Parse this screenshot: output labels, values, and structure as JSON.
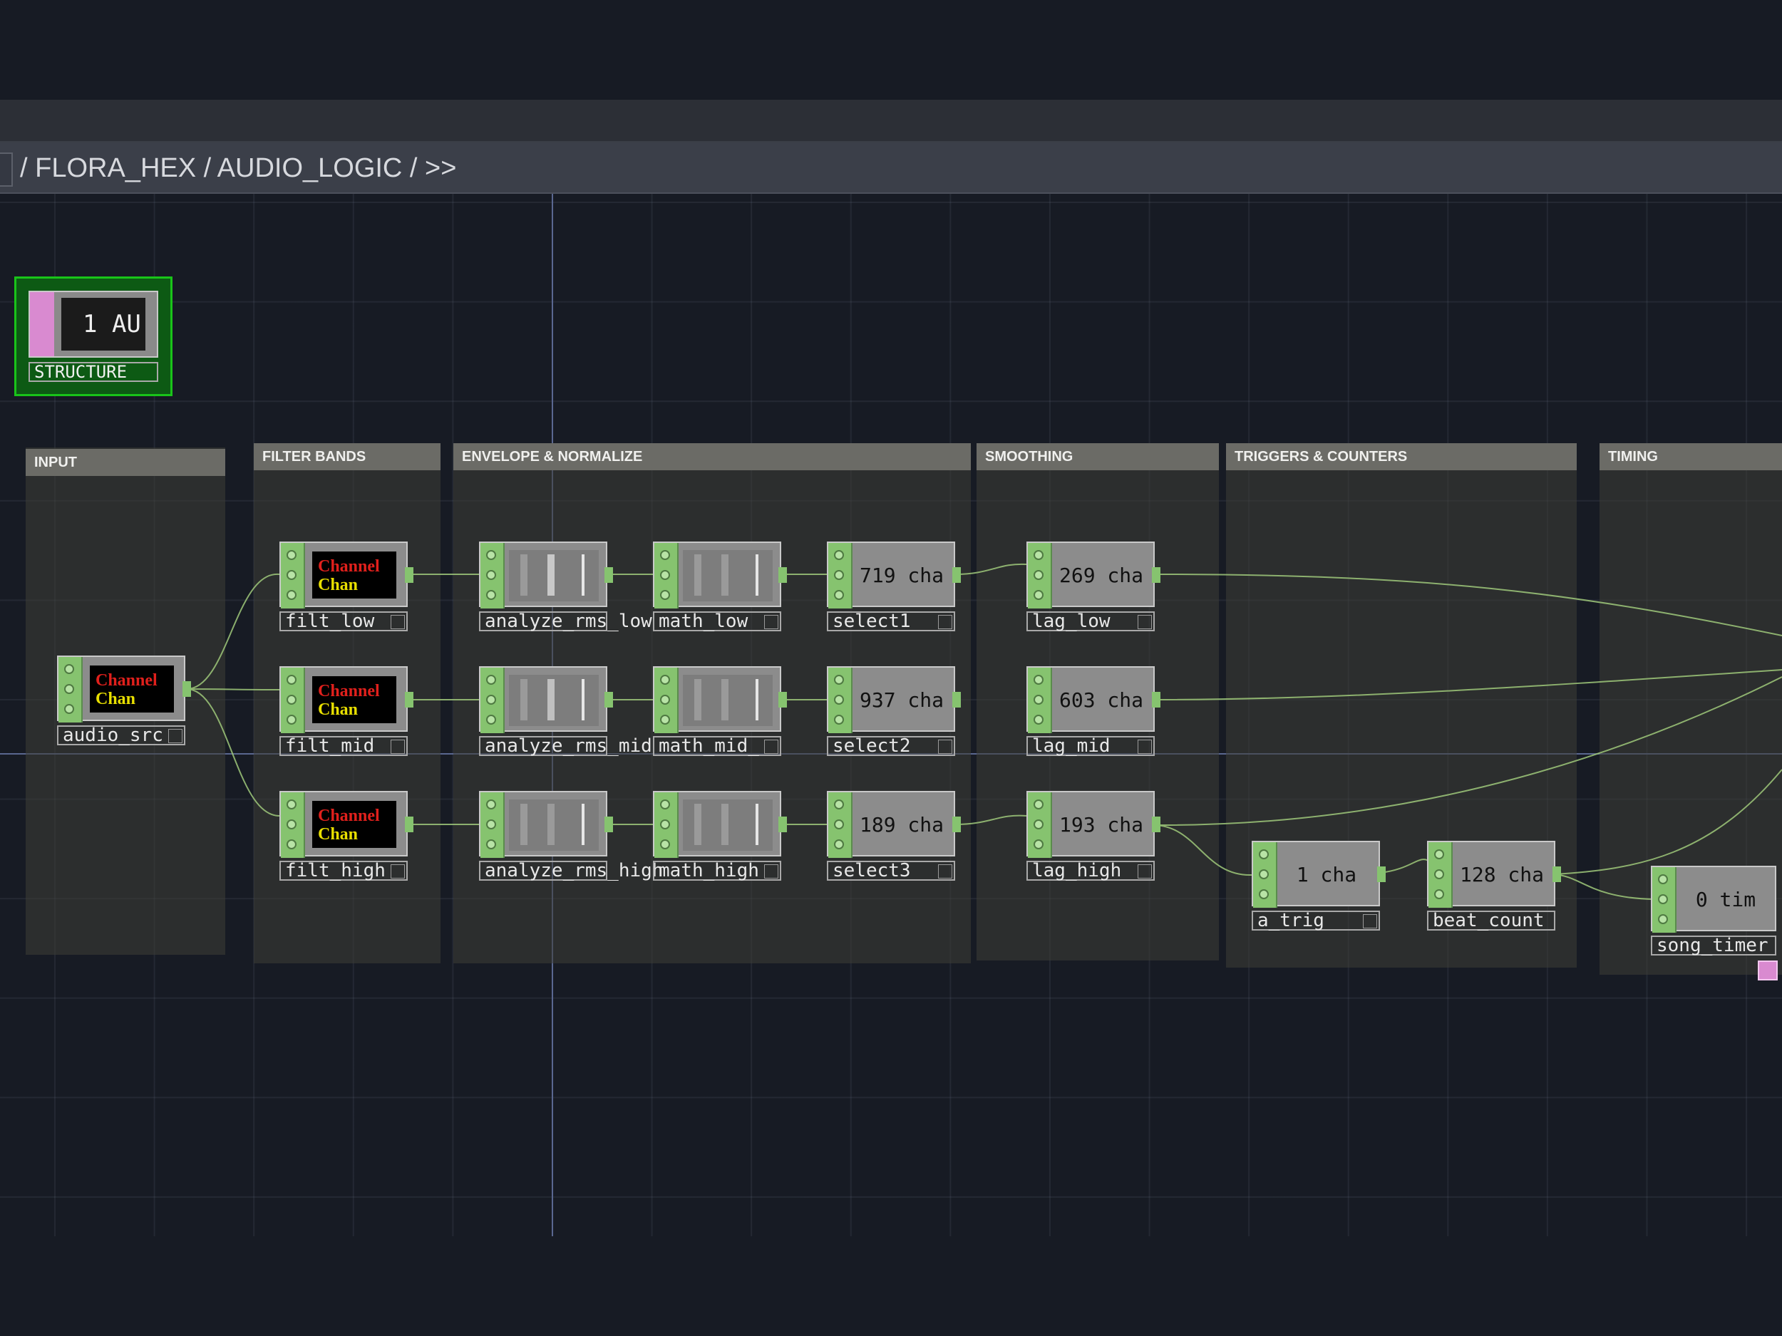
{
  "breadcrumb": {
    "text": "/ FLORA_HEX / AUDIO_LOGIC / >>"
  },
  "structure": {
    "label": "STRUCTURE",
    "view_text": "1  AU"
  },
  "boxes": [
    {
      "title": "INPUT"
    },
    {
      "title": "FILTER BANDS"
    },
    {
      "title": "ENVELOPE & NORMALIZE"
    },
    {
      "title": "SMOOTHING"
    },
    {
      "title": "TRIGGERS & COUNTERS"
    },
    {
      "title": "TIMING"
    }
  ],
  "nodes": {
    "audio_src": {
      "label": "audio_src",
      "thumb_red": "Channel",
      "thumb_yellow": "Chan"
    },
    "filt_low": {
      "label": "filt_low",
      "thumb_red": "Channel",
      "thumb_yellow": "Chan"
    },
    "filt_mid": {
      "label": "filt_mid",
      "thumb_red": "Channel",
      "thumb_yellow": "Chan"
    },
    "filt_high": {
      "label": "filt_high",
      "thumb_red": "Channel",
      "thumb_yellow": "Chan"
    },
    "analyze_rms_low": {
      "label": "analyze_rms_low"
    },
    "analyze_rms_mid": {
      "label": "analyze_rms_mid"
    },
    "analyze_rms_high": {
      "label": "analyze_rms_high"
    },
    "math_low": {
      "label": "math_low"
    },
    "math_mid": {
      "label": "math_mid_"
    },
    "math_high": {
      "label": "math_high"
    },
    "select1": {
      "label": "select1",
      "value": "719 cha"
    },
    "select2": {
      "label": "select2",
      "value": "937 cha"
    },
    "select3": {
      "label": "select3",
      "value": "189 cha"
    },
    "lag_low": {
      "label": "lag_low",
      "value": "269 cha"
    },
    "lag_mid": {
      "label": "lag_mid",
      "value": "603 cha"
    },
    "lag_high": {
      "label": "lag_high",
      "value": "193 cha"
    },
    "a_trig": {
      "label": "a_trig",
      "value": "1 cha"
    },
    "beat_count": {
      "label": "beat_count",
      "value": "128 cha"
    },
    "song_timer": {
      "label": "song_timer",
      "value": "0 tim"
    }
  },
  "colors": {
    "background": "#171b24",
    "node_green": "#86c36f",
    "structure_green": "#19c419",
    "wire": "#9fc87a",
    "box_header": "#6b6b66"
  }
}
